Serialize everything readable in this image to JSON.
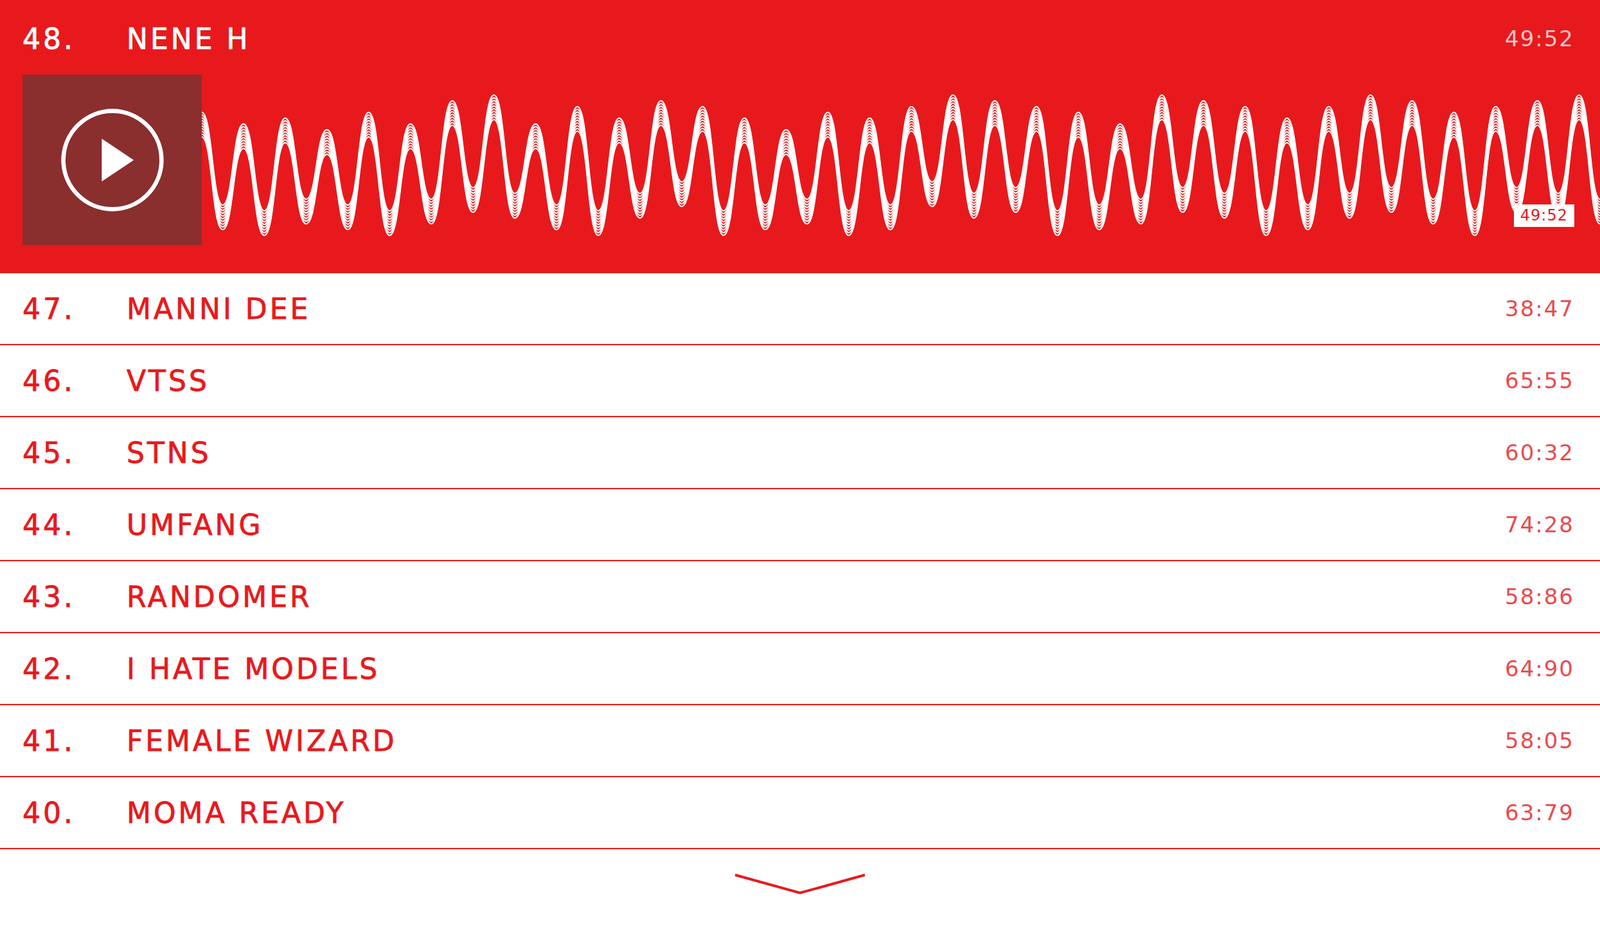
{
  "now_playing": {
    "rank": "48.",
    "artist": "NENE H",
    "duration": "49:52",
    "position": "49:52",
    "playing": false
  },
  "waveform": [
    0.7,
    0.9,
    0.5,
    1.0,
    0.6,
    0.8,
    0.4,
    0.9,
    0.7,
    1.0,
    0.5,
    0.8,
    0.9,
    0.6,
    1.0,
    0.7,
    0.5,
    0.9,
    0.8,
    1.0,
    0.6,
    0.7,
    0.9,
    0.5,
    0.8,
    1.0,
    0.6,
    0.9,
    0.4,
    0.8,
    0.7,
    1.0,
    0.6,
    0.9,
    0.8,
    0.5,
    1.0,
    0.7,
    0.9,
    0.6,
    0.8,
    1.0,
    0.7,
    0.9,
    0.5,
    0.8,
    1.0,
    0.6,
    0.9,
    0.7,
    0.8,
    1.0,
    0.6,
    0.9,
    0.8,
    0.7,
    1.0,
    0.6,
    0.9,
    0.8,
    0.7,
    1.0,
    0.8,
    0.6,
    0.9,
    0.7,
    1.0,
    0.8
  ],
  "tracks": [
    {
      "rank": "47.",
      "artist": "MANNI DEE",
      "duration": "38:47"
    },
    {
      "rank": "46.",
      "artist": "VTSS",
      "duration": "65:55"
    },
    {
      "rank": "45.",
      "artist": "STNS",
      "duration": "60:32"
    },
    {
      "rank": "44.",
      "artist": "UMFANG",
      "duration": "74:28"
    },
    {
      "rank": "43.",
      "artist": "RANDOMER",
      "duration": "58:86"
    },
    {
      "rank": "42.",
      "artist": "I HATE MODELS",
      "duration": "64:90"
    },
    {
      "rank": "41.",
      "artist": "FEMALE WIZARD",
      "duration": "58:05"
    },
    {
      "rank": "40.",
      "artist": "MOMA READY",
      "duration": "63:79"
    }
  ]
}
